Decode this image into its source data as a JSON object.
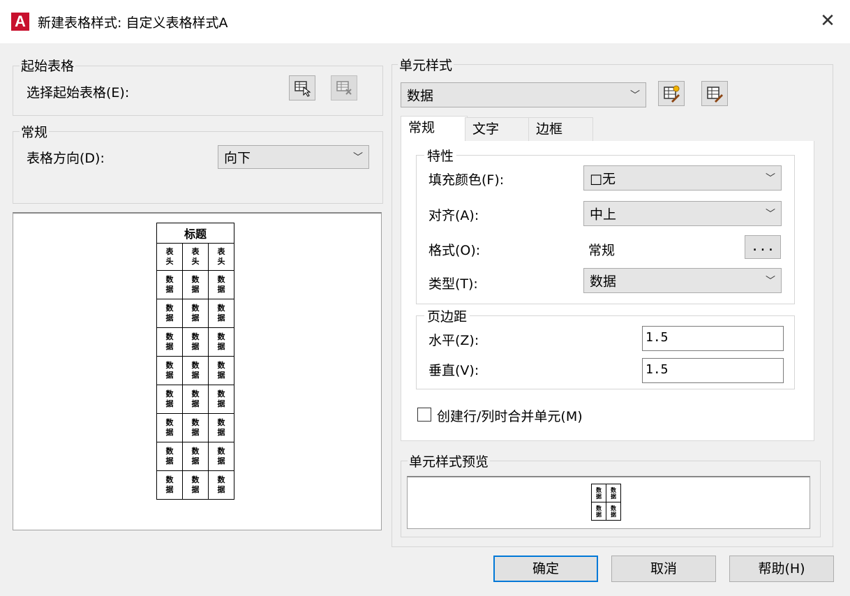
{
  "window": {
    "title": "新建表格样式: 自定义表格样式A",
    "logo_letter": "A"
  },
  "starting_table": {
    "group_label": "起始表格",
    "select_label": "选择起始表格(E):",
    "select_icon": "table-select-icon",
    "remove_icon": "table-remove-icon"
  },
  "general": {
    "group_label": "常规",
    "direction_label": "表格方向(D):",
    "direction_value": "向下"
  },
  "table_preview": {
    "title": "标题",
    "header_cells": [
      "表\n头",
      "表\n头",
      "表\n头"
    ],
    "data_cell": "数\n据",
    "data_row_count": 8
  },
  "cell_style": {
    "group_label": "单元样式",
    "value": "数据",
    "new_style_icon": "new-cell-style-icon",
    "manage_style_icon": "manage-cell-styles-icon",
    "tabs": [
      "常规",
      "文字",
      "边框"
    ],
    "properties": {
      "group_label": "特性",
      "fill_label": "填充颜色(F):",
      "fill_value": "□无",
      "align_label": "对齐(A):",
      "align_value": "中上",
      "format_label": "格式(O):",
      "format_value": "常规",
      "format_button": "...",
      "type_label": "类型(T):",
      "type_value": "数据"
    },
    "margins": {
      "group_label": "页边距",
      "horizontal_label": "水平(Z):",
      "horizontal_value": "1.5",
      "vertical_label": "垂直(V):",
      "vertical_value": "1.5"
    },
    "merge_label": "创建行/列时合并单元(M)",
    "merge_checked": false,
    "preview_label": "单元样式预览",
    "preview_cell": "数\n据"
  },
  "buttons": {
    "ok": "确定",
    "cancel": "取消",
    "help": "帮助(H)"
  }
}
